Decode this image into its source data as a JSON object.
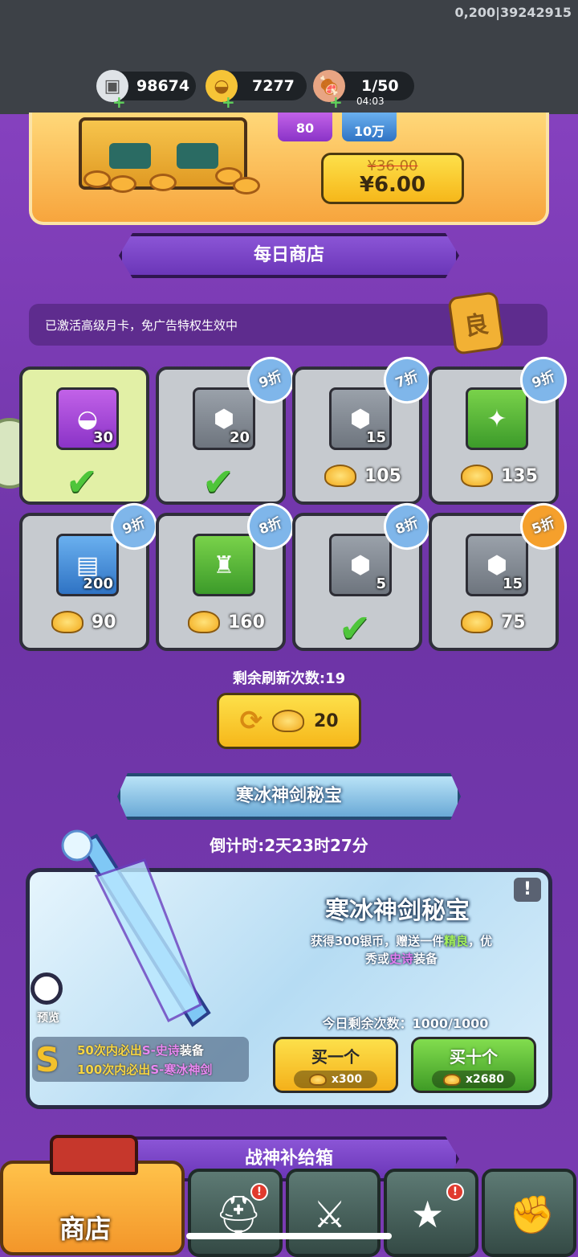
{
  "debug": "0,200|39242915",
  "resources": [
    {
      "name": "silver",
      "value": "98674",
      "icon": "silver-coin-icon"
    },
    {
      "name": "gold",
      "value": "7277",
      "icon": "gold-ingot-icon"
    },
    {
      "name": "stamina",
      "value": "1/50",
      "icon": "meat-leg-icon",
      "timer": "04:03"
    }
  ],
  "banner": {
    "item1_qty": "80",
    "item2_qty": "10万",
    "old_price": "¥36.00",
    "new_price": "¥6.00"
  },
  "daily_shop": {
    "title": "每日商店",
    "notice": "已激活高级月卡，免广告特权生效中",
    "card_badge": "良",
    "items": [
      {
        "qty": "30",
        "color": "purple",
        "icon": "gold-ingot-icon",
        "discount": "",
        "cost": "",
        "purchased": true
      },
      {
        "qty": "20",
        "color": "grey",
        "icon": "helmet-crystal-icon",
        "discount": "9折",
        "cost": "",
        "purchased": true
      },
      {
        "qty": "15",
        "color": "grey",
        "icon": "medal-crystal-icon",
        "discount": "7折",
        "cost": "105",
        "purchased": false
      },
      {
        "qty": "",
        "color": "green",
        "icon": "crystal-cluster-icon",
        "discount": "9折",
        "cost": "135",
        "purchased": false
      },
      {
        "qty": "200",
        "color": "blue",
        "icon": "scroll-icon",
        "discount": "9折",
        "cost": "90",
        "purchased": false
      },
      {
        "qty": "",
        "color": "green",
        "icon": "armor-icon",
        "discount": "8折",
        "cost": "160",
        "purchased": false
      },
      {
        "qty": "5",
        "color": "grey",
        "icon": "boot-crystal-icon",
        "discount": "8折",
        "cost": "",
        "purchased": true
      },
      {
        "qty": "15",
        "color": "grey",
        "icon": "boot-crystal-icon",
        "discount": "5折",
        "cost": "75",
        "purchased": false
      }
    ],
    "refresh_label": "剩余刷新次数:19",
    "refresh_cost": "20"
  },
  "ice_event": {
    "header": "寒冰神剑秘宝",
    "countdown": "倒计时:2天23时27分",
    "title": "寒冰神剑秘宝",
    "desc_a": "获得300银币，赠送一件",
    "desc_good": "精良",
    "desc_b": "，优",
    "desc_c": "秀或",
    "desc_epic": "史诗",
    "desc_d": "装备",
    "today": "今日剩余次数：1000/1000",
    "preview": "预览",
    "pity_grade": "S",
    "pity1_a": "50次内必出",
    "pity1_b": "S-史诗",
    "pity1_c": "装备",
    "pity2_a": "100次内必出",
    "pity2_b": "S-寒冰神剑",
    "buy_one": "买一个",
    "buy_one_price": "x300",
    "buy_ten": "买十个",
    "buy_ten_price": "x2680",
    "warn": "!"
  },
  "next_section": "战神补给箱",
  "nav": {
    "shop": "商店",
    "tabs": [
      "helmet-icon",
      "crossed-swords-icon",
      "hero-stars-icon",
      "fist-upgrade-icon"
    ]
  }
}
